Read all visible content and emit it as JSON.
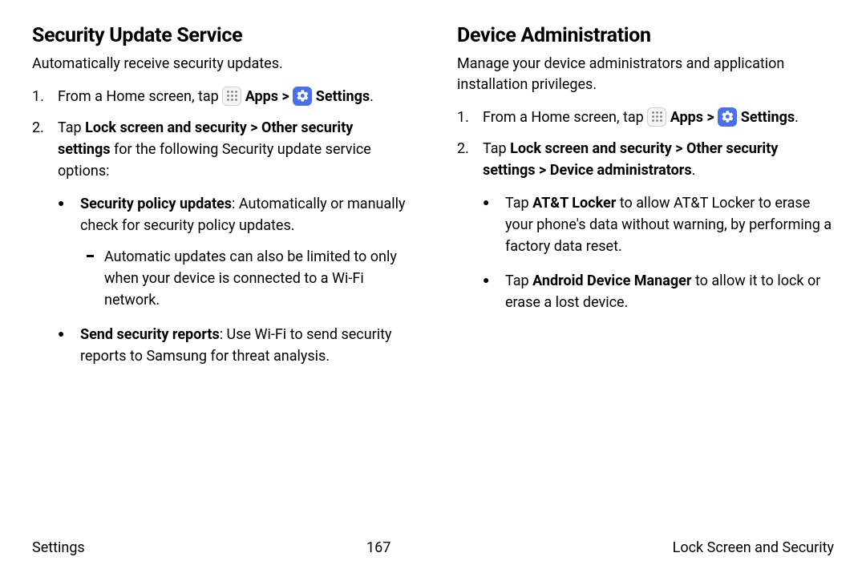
{
  "left": {
    "heading": "Security Update Service",
    "intro": "Automatically receive security updates.",
    "step1_prefix": "From a Home screen, tap ",
    "apps_label": "Apps",
    "caret": " > ",
    "settings_label": "Settings",
    "period": ".",
    "step2_a": "Tap ",
    "step2_b": "Lock screen and security > Other security settings",
    "step2_c": " for the following Security update service options:",
    "bullet1_a": "Security policy updates",
    "bullet1_b": ": Automatically or manually check for security policy updates.",
    "dash1": "Automatic updates can also be limited to only when your device is connected to a Wi-Fi network.",
    "bullet2_a": "Send security reports",
    "bullet2_b": ": Use Wi-Fi to send security reports to Samsung for threat analysis."
  },
  "right": {
    "heading": "Device Administration",
    "intro": "Manage your device administrators and application installation privileges.",
    "step1_prefix": "From a Home screen, tap ",
    "apps_label": "Apps",
    "caret": " > ",
    "settings_label": "Settings",
    "period": ".",
    "step2_a": "Tap ",
    "step2_b": "Lock screen and security > Other security settings > Device administrators",
    "step2_c": ".",
    "bullet1_a": "Tap ",
    "bullet1_b": "AT&T Locker",
    "bullet1_c": " to allow AT&T Locker to erase your phone's data without warning, by performing a factory data reset.",
    "bullet2_a": "Tap ",
    "bullet2_b": "Android Device Manager",
    "bullet2_c": " to allow it to lock or erase a lost device."
  },
  "footer": {
    "left": "Settings",
    "center": "167",
    "right": "Lock Screen and Security"
  }
}
